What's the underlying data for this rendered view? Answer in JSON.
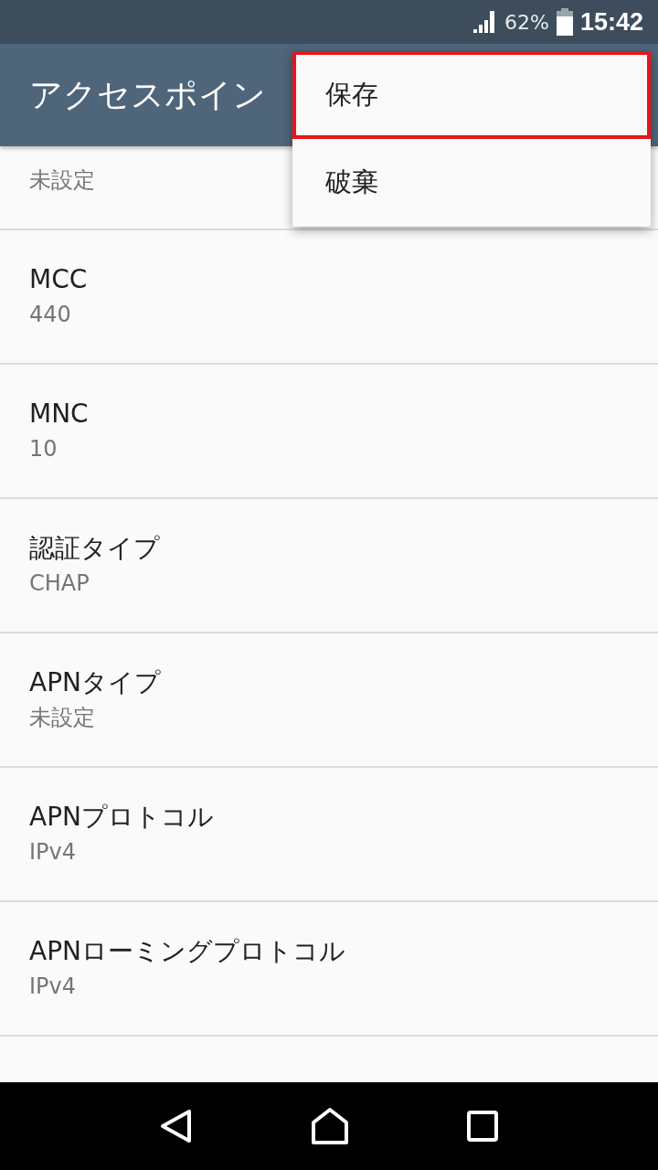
{
  "status_bar": {
    "battery_text": "62%",
    "time": "15:42"
  },
  "app_bar": {
    "title": "アクセスポイン"
  },
  "menu": [
    {
      "label": "保存",
      "highlighted": true
    },
    {
      "label": "破棄",
      "highlighted": false
    }
  ],
  "settings": [
    {
      "value": "未設定"
    },
    {
      "title": "MCC",
      "value": "440"
    },
    {
      "title": "MNC",
      "value": "10"
    },
    {
      "title": "認証タイプ",
      "value": "CHAP"
    },
    {
      "title": "APNタイプ",
      "value": "未設定"
    },
    {
      "title": "APNプロトコル",
      "value": "IPv4"
    },
    {
      "title": "APNローミングプロトコル",
      "value": "IPv4"
    }
  ]
}
